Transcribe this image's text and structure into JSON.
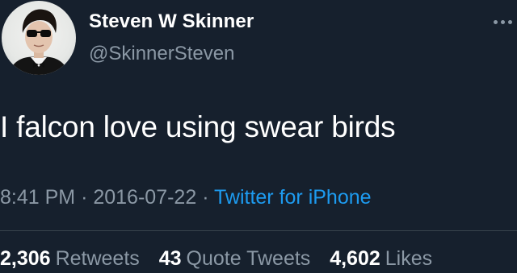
{
  "user": {
    "display_name": "Steven W Skinner",
    "handle": "@SkinnerSteven"
  },
  "tweet": {
    "text": "I falcon love using swear birds",
    "time": "8:41 PM",
    "date": "2016-07-22",
    "separator": "·",
    "source": "Twitter for iPhone"
  },
  "stats": {
    "retweets_count": "2,306",
    "retweets_label": "Retweets",
    "quotes_count": "43",
    "quotes_label": "Quote Tweets",
    "likes_count": "4,602",
    "likes_label": "Likes"
  },
  "icons": {
    "more": "more-horizontal-icon"
  },
  "colors": {
    "background": "#16202d",
    "primary_text": "#ffffff",
    "secondary_text": "#8b98a5",
    "link": "#1d9bf0",
    "divider": "#38444d"
  }
}
